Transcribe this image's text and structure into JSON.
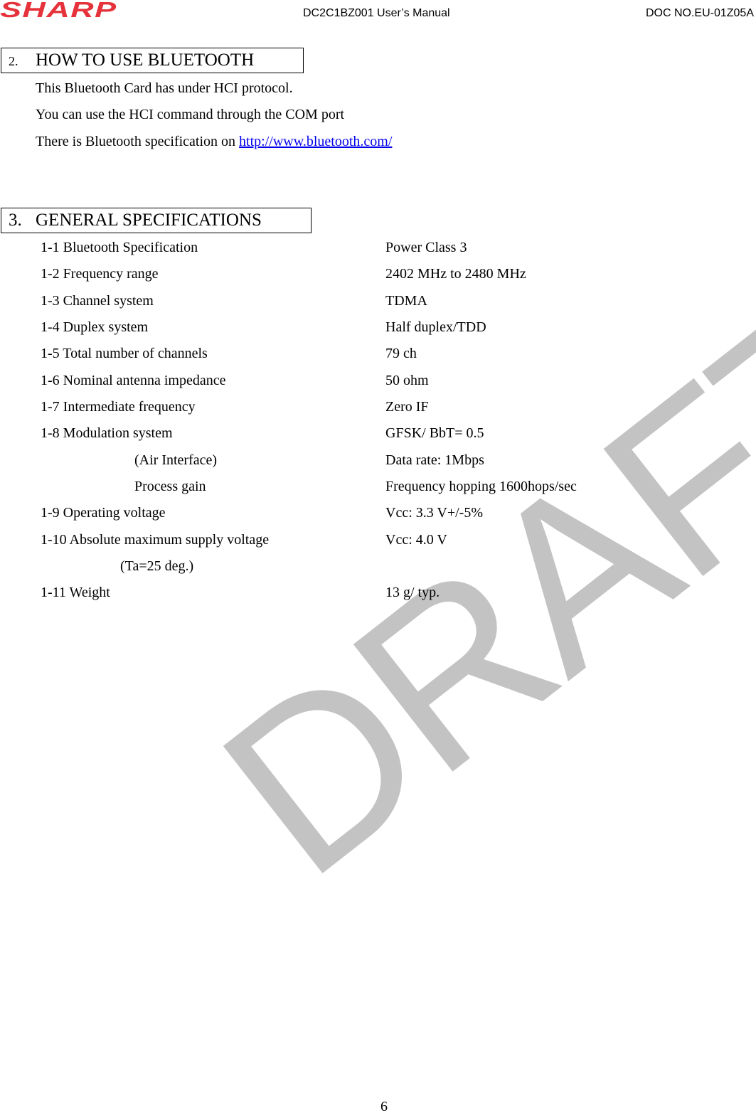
{
  "header": {
    "logo": "SHARP",
    "title": "DC2C1BZ001 User’s Manual",
    "doc_no": "DOC NO.EU-01Z05A"
  },
  "section2": {
    "number": "2.",
    "title": "HOW TO USE BLUETOOTH",
    "lines": [
      "This Bluetooth Card has under HCI protocol.",
      "You can use the HCI command through the COM port"
    ],
    "spec_line_prefix": "There is Bluetooth specification on ",
    "spec_link": "http://www.bluetooth.com/"
  },
  "section3": {
    "number": "3.",
    "title": "GENERAL SPECIFICATIONS",
    "specs": [
      {
        "label": "1-1 Bluetooth Specification",
        "value": "Power Class 3"
      },
      {
        "label": "1-2 Frequency range",
        "value": "2402 MHz to 2480 MHz"
      },
      {
        "label": "1-3 Channel system",
        "value": "TDMA"
      },
      {
        "label": "1-4 Duplex system",
        "value": "Half duplex/TDD"
      },
      {
        "label": "1-5 Total number of channels",
        "value": "79 ch"
      },
      {
        "label": "1-6 Nominal antenna impedance",
        "value": "50 ohm"
      },
      {
        "label": "1-7 Intermediate frequency",
        "value": "Zero IF"
      },
      {
        "label": "1-8 Modulation system",
        "value": "GFSK/ BbT= 0.5"
      },
      {
        "label": "(Air Interface)",
        "value": "Data rate: 1Mbps"
      },
      {
        "label": "Process gain",
        "value": "Frequency hopping 1600hops/sec"
      },
      {
        "label": "1-9 Operating voltage",
        "value": "Vcc: 3.3 V+/-5%"
      },
      {
        "label": "1-10 Absolute maximum supply voltage",
        "value": "Vcc: 4.0 V"
      },
      {
        "label": "(Ta=25 deg.)",
        "value": ""
      },
      {
        "label": "1-11 Weight",
        "value": "13 g/ typ."
      }
    ]
  },
  "watermark": "DRAFT",
  "footer": {
    "page_number": "6"
  }
}
